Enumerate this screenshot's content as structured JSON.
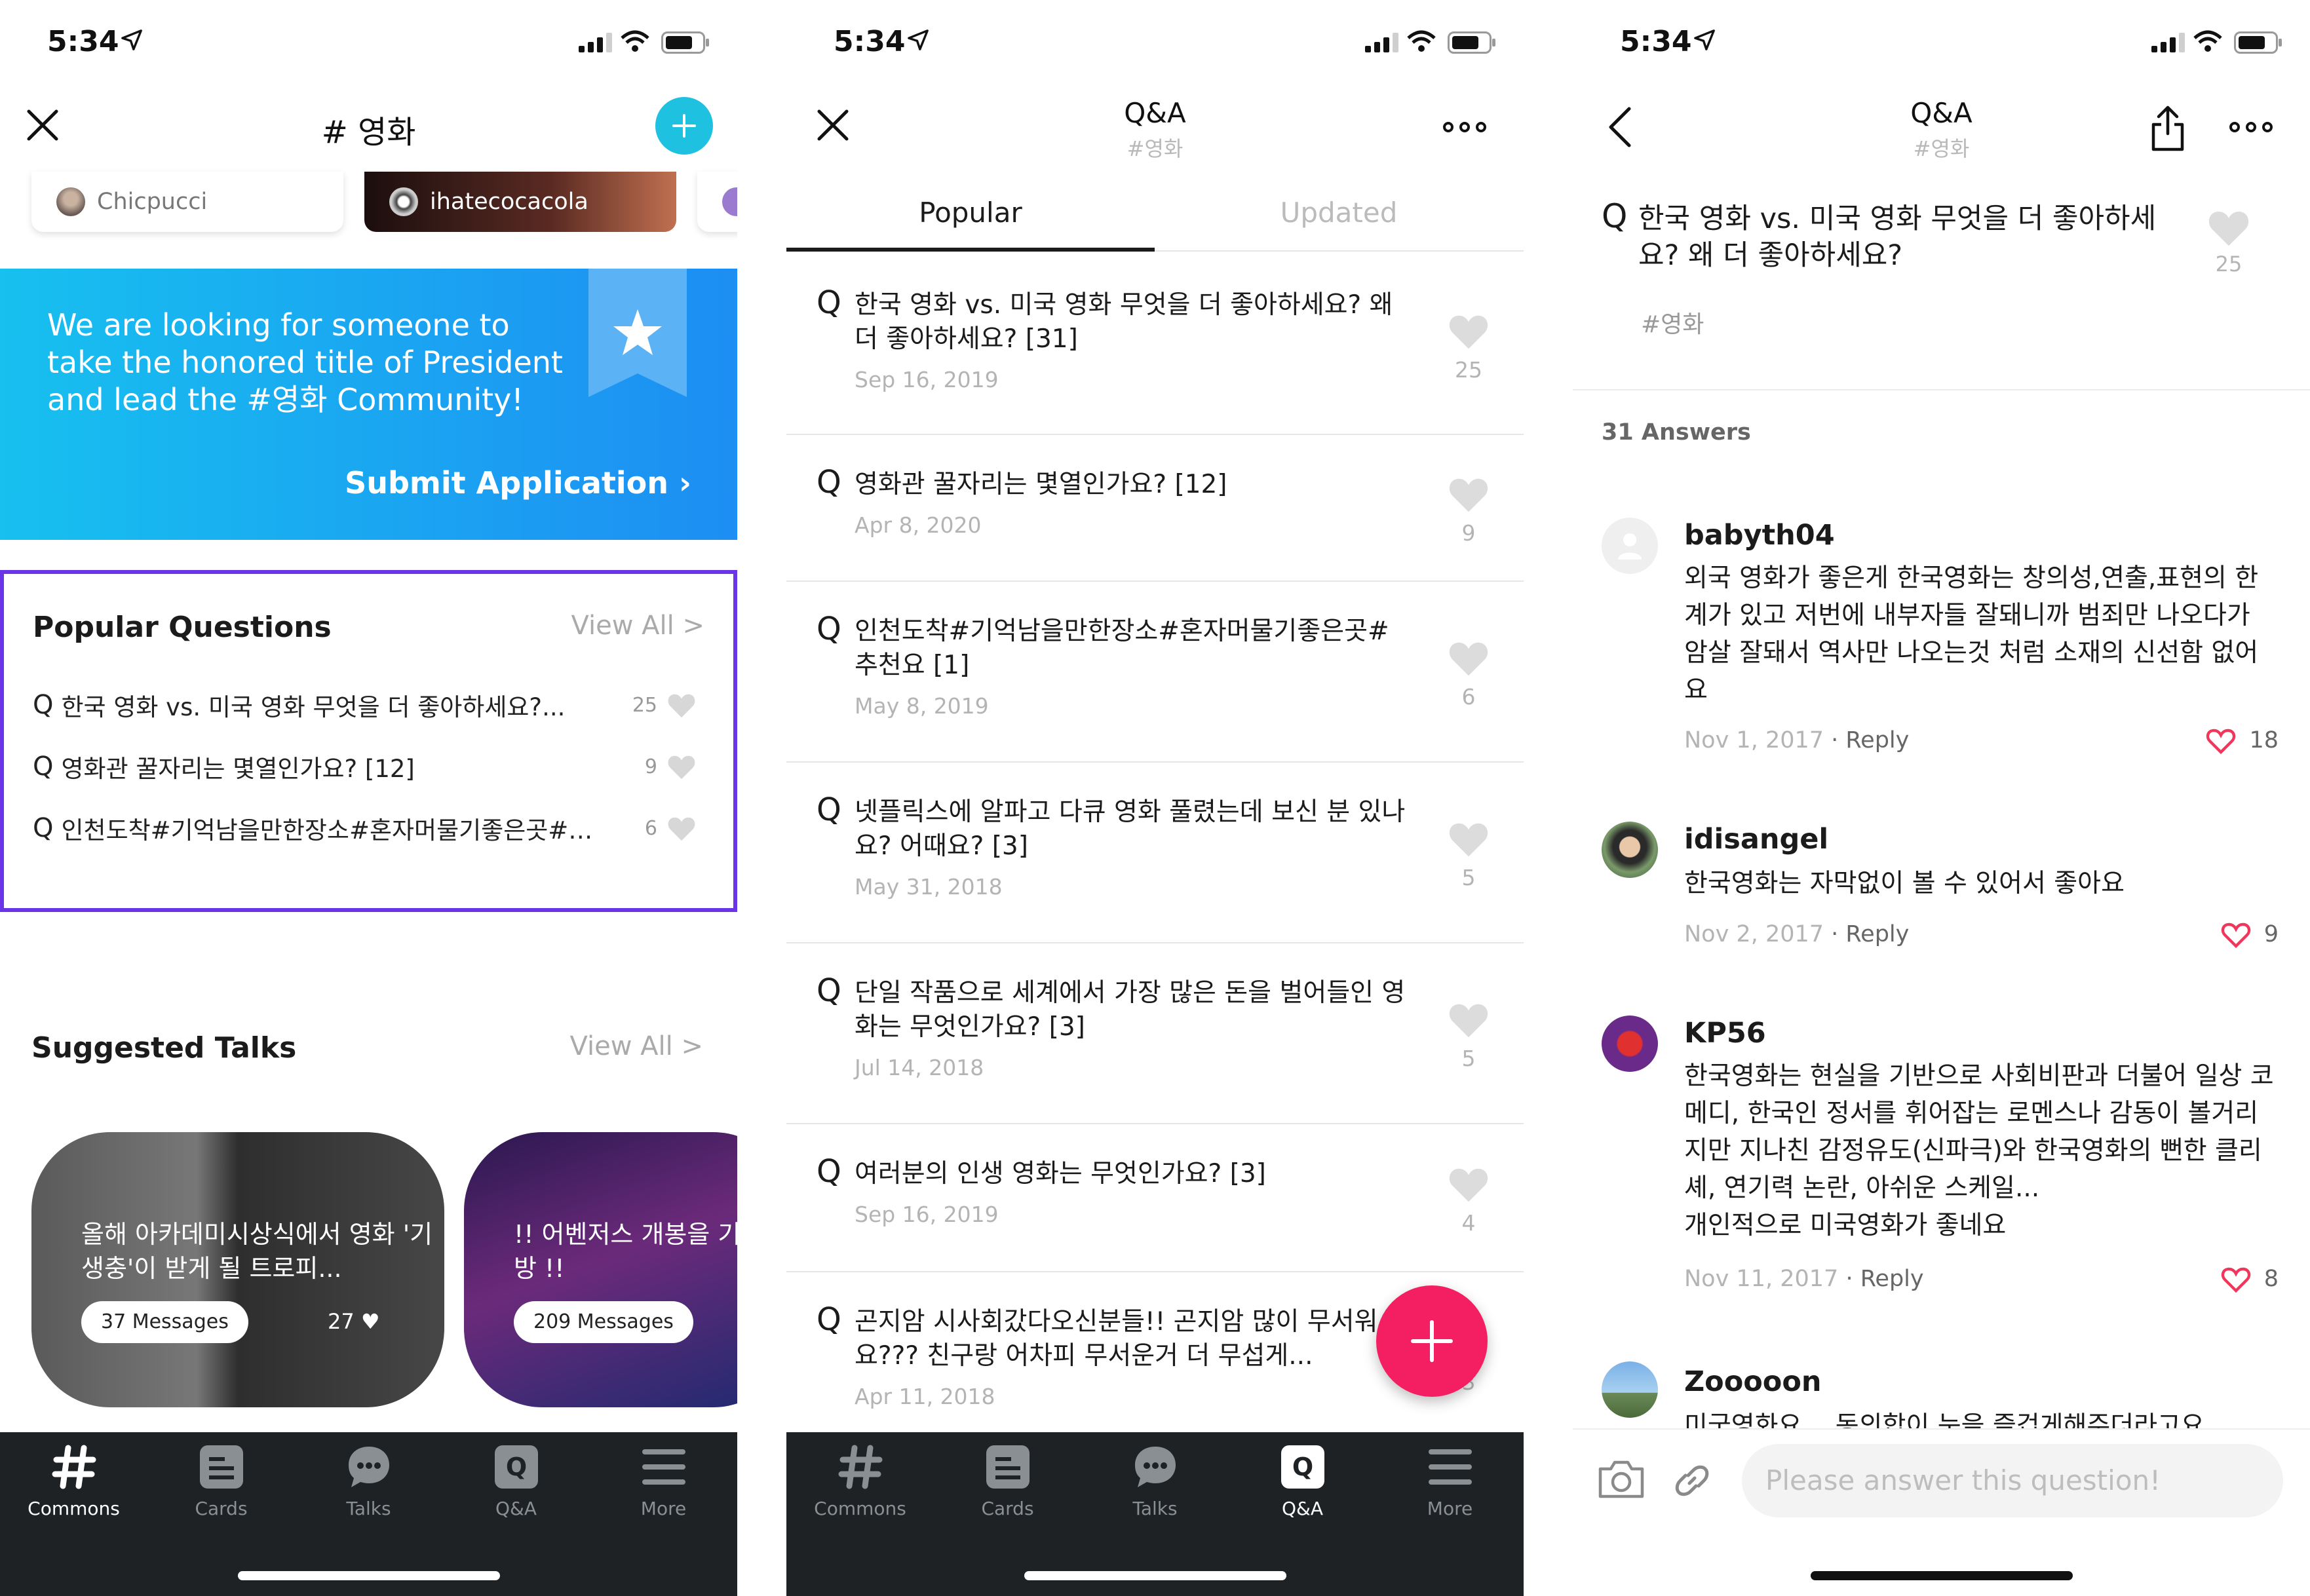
{
  "status": {
    "time": "5:34"
  },
  "screen1": {
    "title": "# 영화",
    "users": [
      "Chicpucci",
      "ihatecocacola"
    ],
    "banner": {
      "text": "We are looking for someone to take the honored title of President and lead the #영화 Community!",
      "submit": "Submit Application"
    },
    "popular": {
      "title": "Popular Questions",
      "view_all": "View All >",
      "items": [
        {
          "q": "Q",
          "text": "한국 영화 vs. 미국 영화 무엇을 더 좋아하세요?...",
          "count": "25"
        },
        {
          "q": "Q",
          "text": "영화관 꿀자리는 몇열인가요?  [12]",
          "count": "9"
        },
        {
          "q": "Q",
          "text": "인천도착#기억남을만한장소#혼자머물기좋은곳#…",
          "count": "6"
        }
      ]
    },
    "talks": {
      "title": "Suggested Talks",
      "view_all": "View All >",
      "items": [
        {
          "text": "올해 아카데미시상식에서 영화 '기생충'이 받게 될 트로피...",
          "messages": "37 Messages",
          "likes": "27"
        },
        {
          "text": "!! 어벤저스 개봉을 기다 방 !!",
          "messages": "209 Messages"
        }
      ]
    }
  },
  "tabs": [
    {
      "label": "Commons",
      "icon": "hash-icon"
    },
    {
      "label": "Cards",
      "icon": "cards-icon"
    },
    {
      "label": "Talks",
      "icon": "talks-icon"
    },
    {
      "label": "Q&A",
      "icon": "qa-icon"
    },
    {
      "label": "More",
      "icon": "menu-icon"
    }
  ],
  "screen2": {
    "title": "Q&A",
    "subtitle": "#영화",
    "tab_popular": "Popular",
    "tab_updated": "Updated",
    "questions": [
      {
        "q": "Q",
        "text": "한국 영화 vs. 미국 영화 무엇을 더 좋아하세요? 왜 더 좋아하세요?  [31]",
        "date": "Sep 16, 2019",
        "likes": "25"
      },
      {
        "q": "Q",
        "text": "영화관 꿀자리는 몇열인가요?  [12]",
        "date": "Apr 8, 2020",
        "likes": "9"
      },
      {
        "q": "Q",
        "text": "인천도착#기억남을만한장소#혼자머물기좋은곳#추천요  [1]",
        "date": "May 8, 2019",
        "likes": "6"
      },
      {
        "q": "Q",
        "text": "넷플릭스에 알파고 다큐 영화 풀렸는데 보신 분 있나요? 어때요?  [3]",
        "date": "May 31, 2018",
        "likes": "5"
      },
      {
        "q": "Q",
        "text": "단일 작품으로 세계에서 가장 많은 돈을 벌어들인 영화는 무엇인가요?  [3]",
        "date": "Jul 14, 2018",
        "likes": "5"
      },
      {
        "q": "Q",
        "text": "여러분의 인생 영화는 무엇인가요?  [3]",
        "date": "Sep 16, 2019",
        "likes": "4"
      },
      {
        "q": "Q",
        "text": "곤지암 시사회갔다오신분들!! 곤지암 많이 무서워요??? 친구랑 어차피 무서운거 더 무섭게...",
        "date": "Apr 11, 2018",
        "likes": "3"
      }
    ]
  },
  "screen3": {
    "title": "Q&A",
    "subtitle": "#영화",
    "question": "한국 영화 vs. 미국 영화 무엇을 더 좋아하세요? 왜 더 좋아하세요?",
    "tag": "#영화",
    "likes": "25",
    "answers_header": "31 Answers",
    "answers": [
      {
        "name": "babyth04",
        "text": "외국 영화가 좋은게 한국영화는 창의성,연출,표현의 한계가 있고 저번에 내부자들 잘돼니까 범죄만 나오다가 암살 잘돼서 역사만 나오는것 처럼 소재의 신선함 없어요",
        "date": "Nov 1, 2017",
        "reply": "· Reply",
        "likes": "18"
      },
      {
        "name": "idisangel",
        "text": "한국영화는 자막없이 볼 수 있어서 좋아요",
        "date": "Nov 2, 2017",
        "reply": "· Reply",
        "likes": "9"
      },
      {
        "name": "KP56",
        "text": "한국영화는 현실을 기반으로 사회비판과 더불어 일상 코메디, 한국인 정서를 휘어잡는 로멘스나 감동이 볼거리지만 지나친 감정유도(신파극)와 한국영화의 뻔한 클리셰, 연기력 논란, 아쉬운 스케일...\n개인적으로 미국영화가 좋네요",
        "date": "Nov 11, 2017",
        "reply": "· Reply",
        "likes": "8"
      },
      {
        "name": "Zooooon",
        "text": "미국영화요… 동의합이 눈을 즐겁게해주더라고요"
      }
    ],
    "composer_placeholder": "Please answer this question!"
  }
}
